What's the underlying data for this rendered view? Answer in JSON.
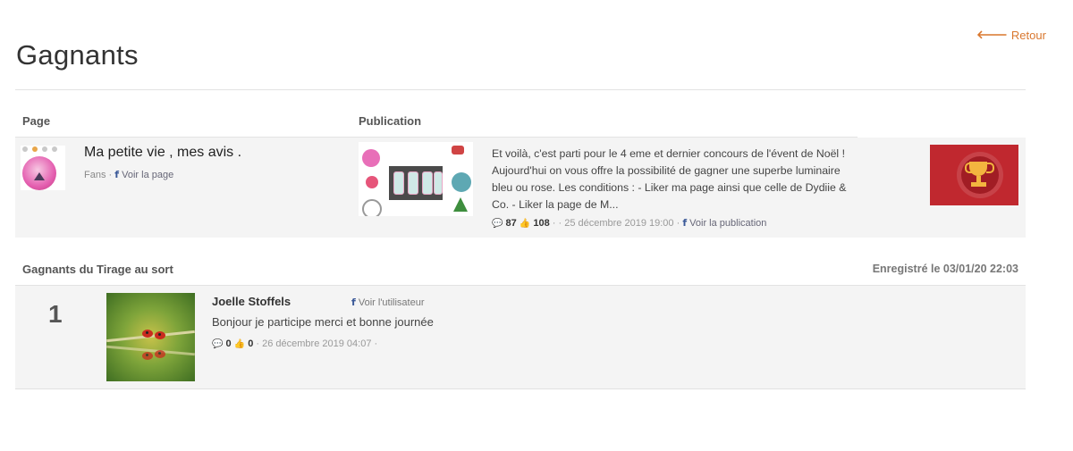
{
  "header": {
    "back_label": "Retour",
    "title": "Gagnants"
  },
  "contest_table": {
    "col_page": "Page",
    "col_publication": "Publication",
    "page": {
      "name": "Ma petite vie , mes avis .",
      "fans_label": "Fans",
      "sep": "·",
      "view_label": "Voir la page"
    },
    "publication": {
      "text": "Et voilà, c'est parti pour le 4 eme et dernier concours de l'évent de Noël ! Aujourd'hui on vous offre la possibilité de gagner une superbe luminaire bleu ou rose. Les conditions : - Liker ma page ainsi que celle de Dydiie & Co. - Liker la page de M...",
      "comments": "87",
      "likes": "108",
      "date": "· · 25 décembre 2019 19:00 ·",
      "view_label": "Voir la publication"
    }
  },
  "winners_table": {
    "title": "Gagnants du Tirage au sort",
    "registered": "Enregistré le 03/01/20 22:03",
    "winners": [
      {
        "rank": "1",
        "name": "Joelle Stoffels",
        "view_label": "Voir l'utilisateur",
        "comment": "Bonjour je participe merci et bonne journée",
        "comments": "0",
        "likes": "0",
        "date": "· 26 décembre 2019 04:07 ·"
      }
    ]
  },
  "icons": {
    "back": "arrow-left-icon",
    "facebook": "facebook-icon",
    "comment": "comment-icon",
    "like": "thumbs-up-icon",
    "trophy": "trophy-icon"
  },
  "colors": {
    "accent": "#d9772e",
    "trophy_bg": "#c0282f",
    "row_bg": "#f4f4f4"
  }
}
